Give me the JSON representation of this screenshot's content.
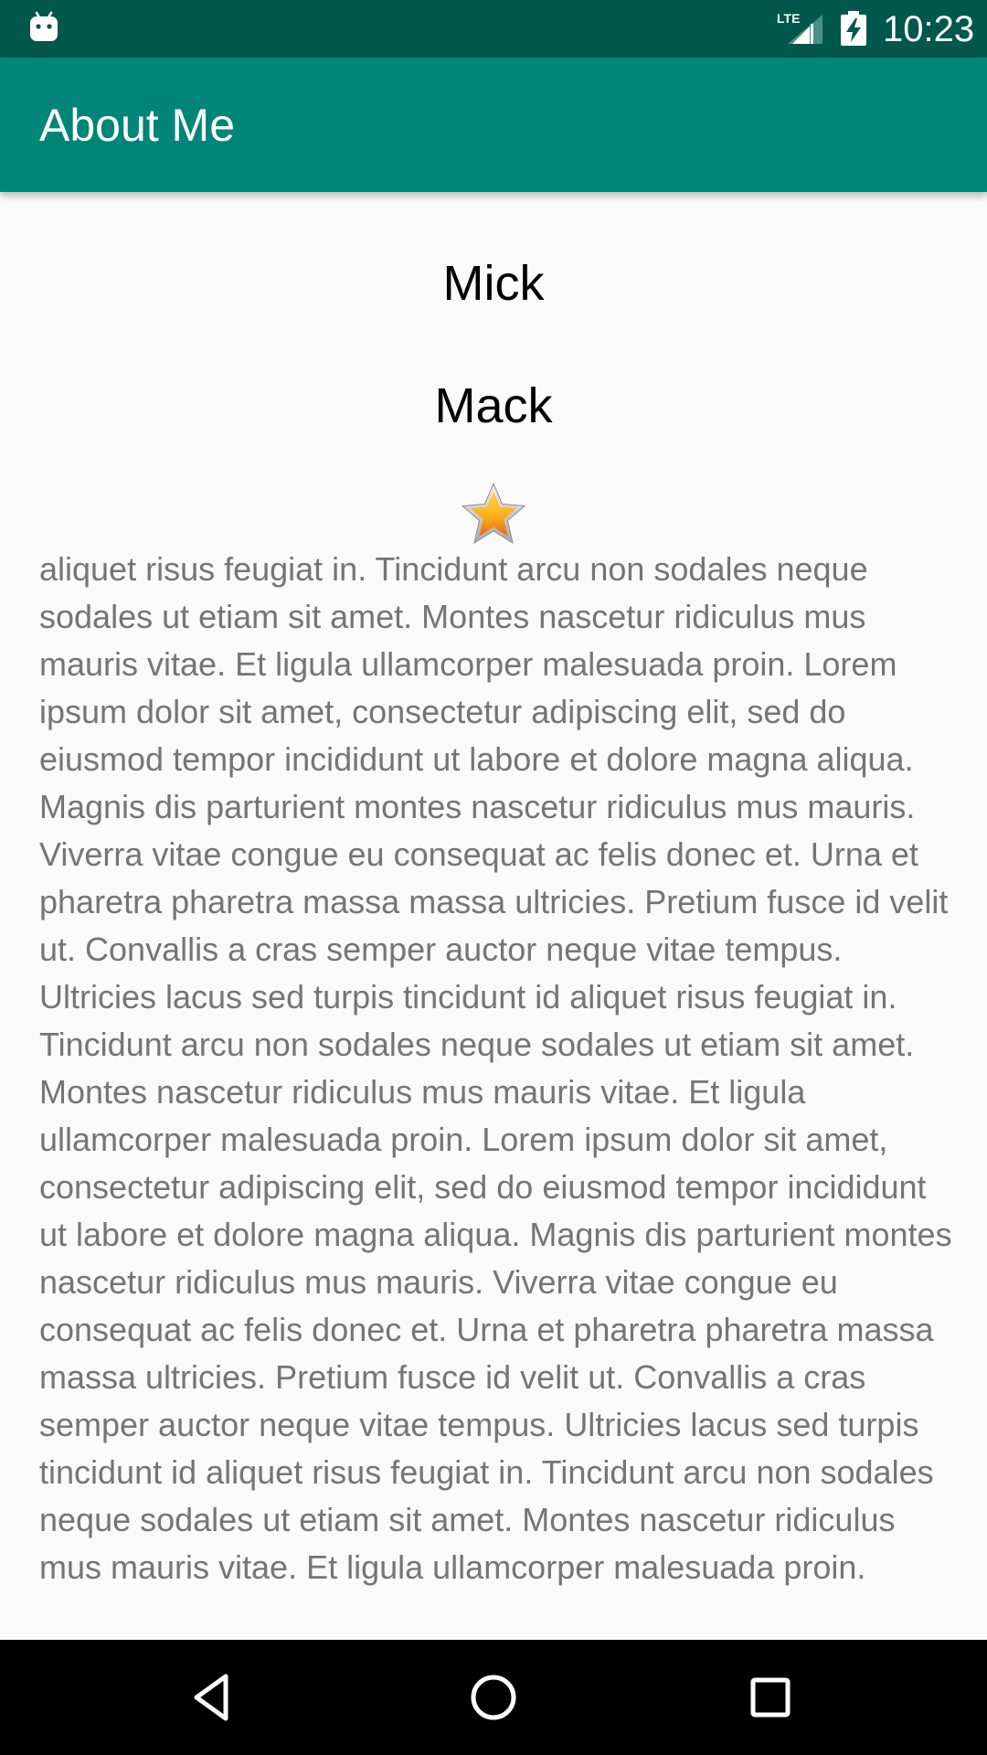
{
  "status_bar": {
    "time": "10:23",
    "network": "LTE",
    "icons": [
      "android-icon",
      "lte-signal-icon",
      "battery-charging-icon"
    ]
  },
  "app_bar": {
    "title": "About Me",
    "color": "#008577"
  },
  "profile": {
    "first_name": "Mick",
    "last_name": "Mack",
    "star_icon": "star-icon",
    "bio": "aliquet risus feugiat in. Tincidunt arcu non sodales neque sodales ut etiam sit amet. Montes nascetur ridiculus mus mauris vitae. Et ligula ullamcorper malesuada proin. Lorem ipsum dolor sit amet, consectetur adipiscing elit, sed do eiusmod tempor incididunt ut labore et dolore magna aliqua. Magnis dis parturient montes nascetur ridiculus mus mauris. Viverra vitae congue eu consequat ac felis donec et. Urna et pharetra pharetra massa massa ultricies. Pretium fusce id velit ut. Convallis a cras semper auctor neque vitae tempus. Ultricies lacus sed turpis tincidunt id aliquet risus feugiat in. Tincidunt arcu non sodales neque sodales ut etiam sit amet. Montes nascetur ridiculus mus mauris vitae. Et ligula ullamcorper malesuada proin. Lorem ipsum dolor sit amet, consectetur adipiscing elit, sed do eiusmod tempor incididunt ut labore et dolore magna aliqua. Magnis dis parturient montes nascetur ridiculus mus mauris. Viverra vitae congue eu consequat ac felis donec et. Urna et pharetra pharetra massa massa ultricies. Pretium fusce id velit ut. Convallis a cras semper auctor neque vitae tempus. Ultricies lacus sed turpis tincidunt id aliquet risus feugiat in. Tincidunt arcu non sodales neque sodales ut etiam sit amet. Montes nascetur ridiculus mus mauris vitae. Et ligula ullamcorper malesuada proin."
  },
  "nav_bar": {
    "buttons": [
      "back-icon",
      "home-icon",
      "recents-icon"
    ]
  },
  "colors": {
    "status_bar": "#00574b",
    "primary": "#008577",
    "background": "#fafafa",
    "bio_text": "#757575"
  }
}
